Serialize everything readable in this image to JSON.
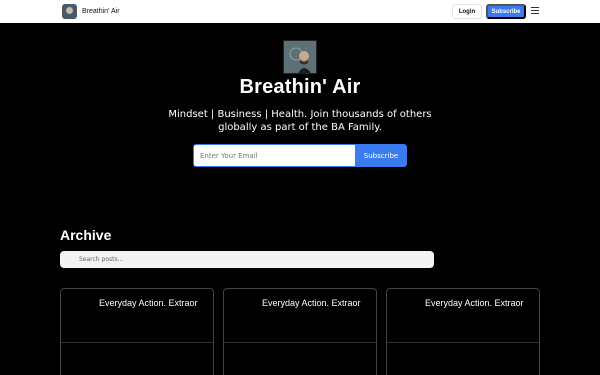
{
  "nav": {
    "brand": "Breathin' Air",
    "login_label": "Login",
    "subscribe_label": "Subscribe",
    "menu_icon": "hamburger-icon"
  },
  "hero": {
    "title": "Breathin' Air",
    "description": "Mindset | Business | Health. Join thousands of others globally as part of the BA Family.",
    "email_placeholder": "Enter Your Email",
    "subscribe_label": "Subscribe"
  },
  "archive": {
    "title": "Archive",
    "search_placeholder": "Search posts...",
    "posts": [
      {
        "title": "Everyday Action. Extraor"
      },
      {
        "title": "Everyday Action. Extraor"
      },
      {
        "title": "Everyday Action. Extraor"
      }
    ]
  },
  "colors": {
    "accent": "#3a7bf0",
    "background": "#000000",
    "nav_background": "#ffffff"
  }
}
